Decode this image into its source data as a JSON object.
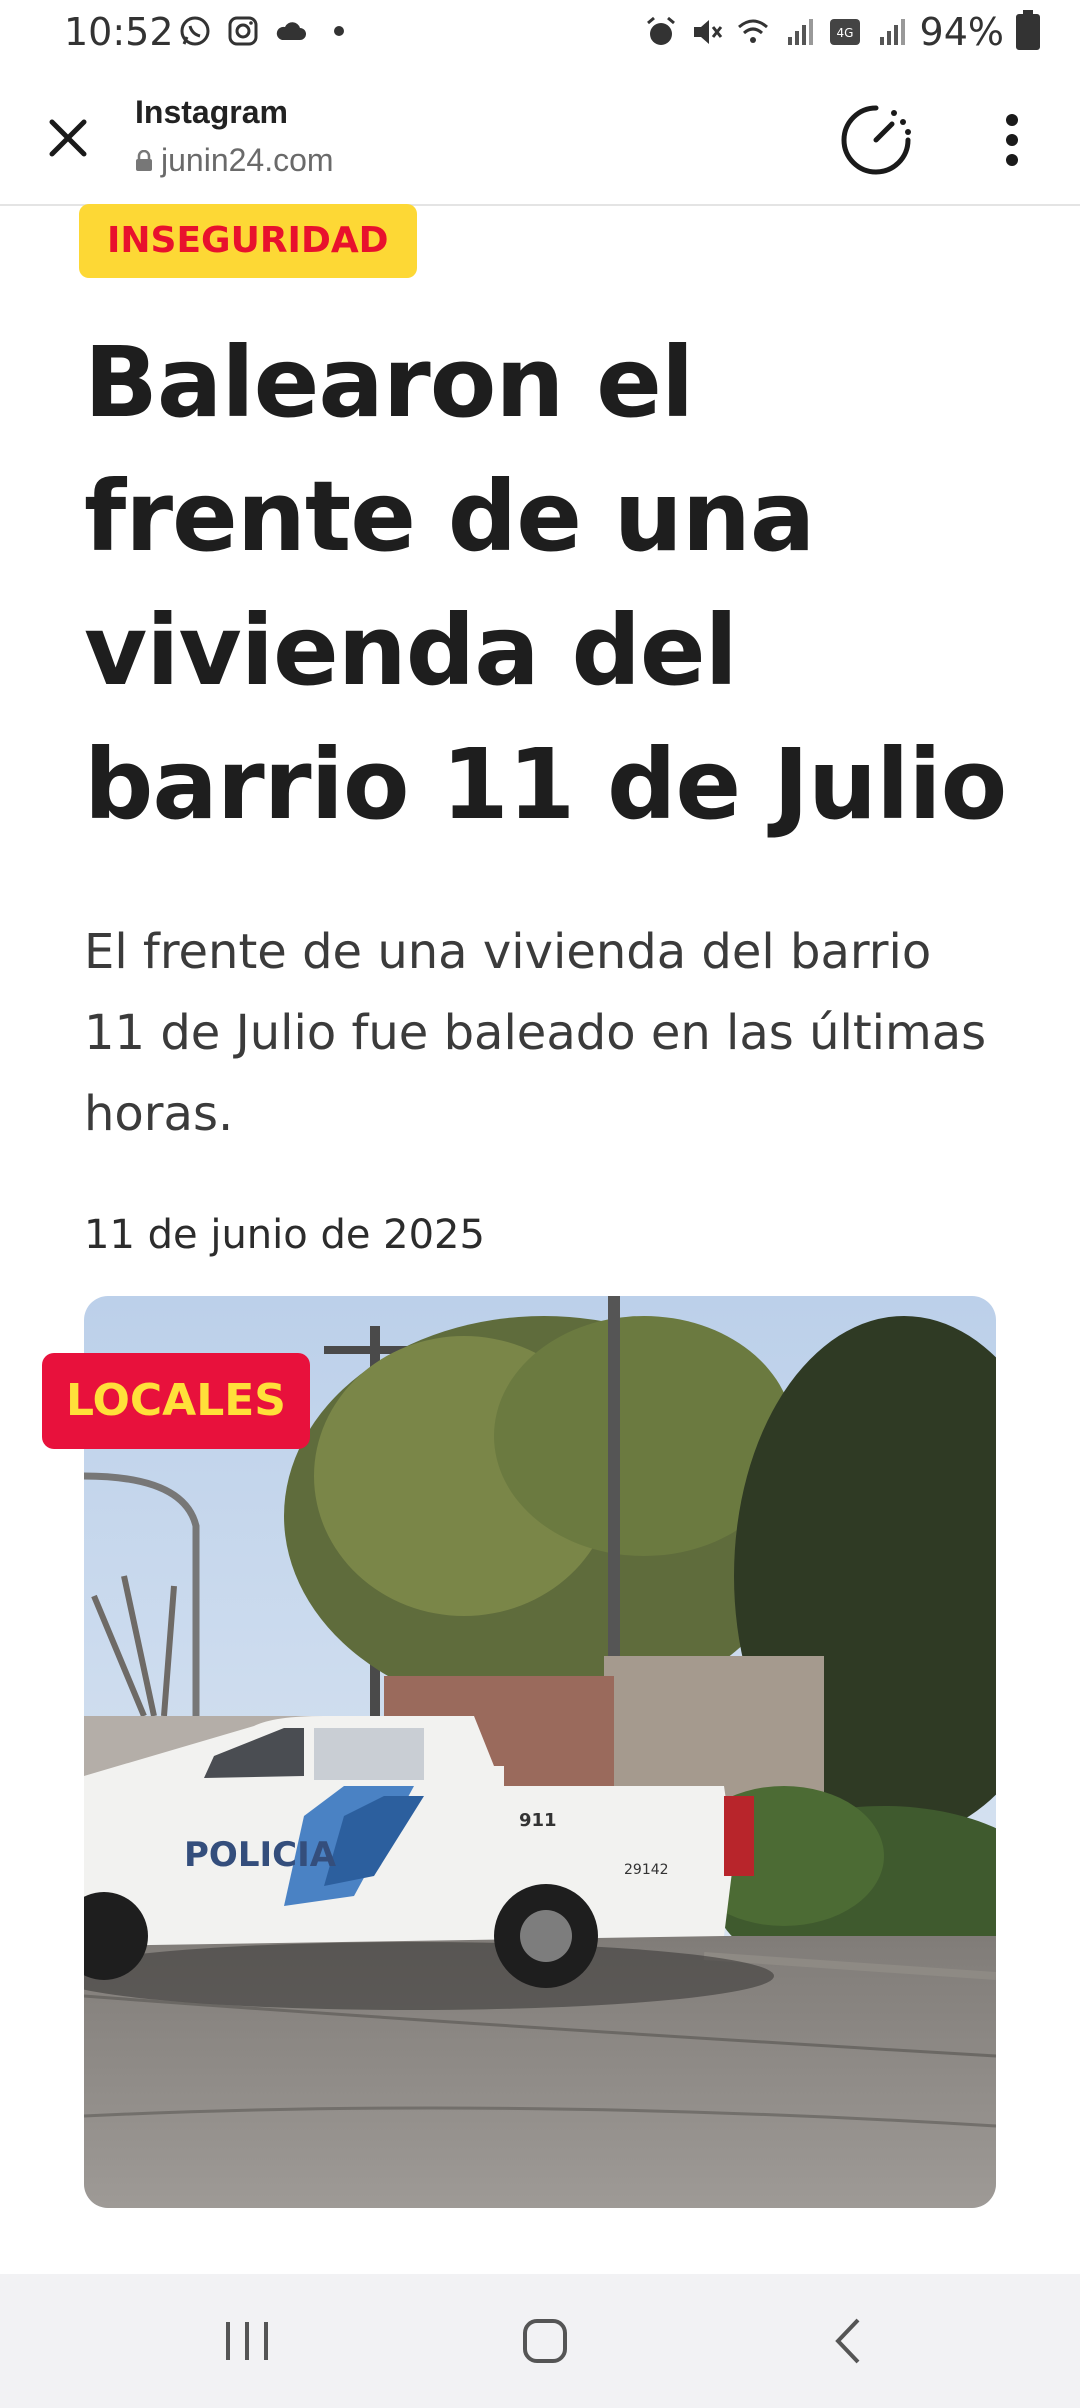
{
  "status_bar": {
    "time": "10:52",
    "battery": "94%",
    "left_icons": [
      "whatsapp-icon",
      "instagram-icon",
      "cloud-icon",
      "dot-icon"
    ],
    "right_icons": [
      "alarm-icon",
      "mute-icon",
      "wifi-icon",
      "signal-icon",
      "volte-icon",
      "signal-icon"
    ]
  },
  "toolbar": {
    "title": "Instagram",
    "url": "junin24.com"
  },
  "article": {
    "category": "INSEGURIDAD",
    "headline": "Balearon el frente de una vivienda del barrio 11 de Julio",
    "summary": "El frente de una vivienda del barrio 11 de Julio fue baleado en las últimas horas.",
    "date": "11 de junio de 2025",
    "image_tag": "LOCALES",
    "image_vehicle_text": "POLICIA",
    "image_vehicle_number": "911",
    "image_vehicle_id": "29142"
  },
  "colors": {
    "category_bg": "#fdd835",
    "category_fg": "#e8112d",
    "locales_bg": "#e8113c",
    "locales_fg": "#ffe03a"
  }
}
